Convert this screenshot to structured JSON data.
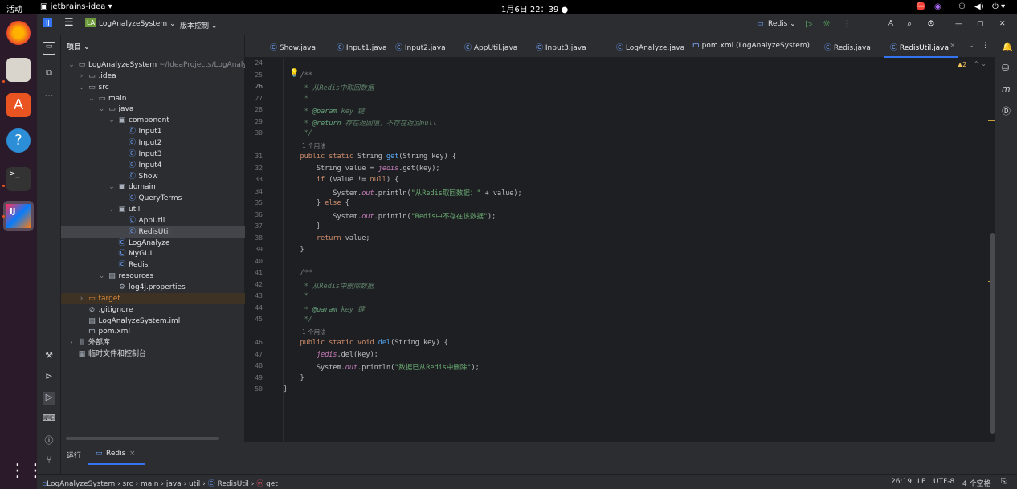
{
  "topbar": {
    "activities": "活动",
    "app_menu": "jetbrains-idea ▾",
    "clock": "1月6日 22：39 ●"
  },
  "header": {
    "project_badge": "LA",
    "project_name": "LogAnalyzeSystem ⌄",
    "vcs": "版本控制 ⌄",
    "run_config": "Redis ⌄"
  },
  "project_panel": {
    "title": "项目 ⌄",
    "tree": [
      {
        "label": "LogAnalyzeSystem",
        "extra": "~/IdeaProjects/LogAnalyzeSystem",
        "arrow": "⌄",
        "icon": "▭"
      },
      {
        "label": ".idea",
        "arrow": "›",
        "icon": "▭"
      },
      {
        "label": "src",
        "arrow": "⌄",
        "icon": "▭"
      },
      {
        "label": "main",
        "arrow": "⌄",
        "icon": "▭"
      },
      {
        "label": "java",
        "arrow": "⌄",
        "icon": "▭"
      },
      {
        "label": "component",
        "arrow": "⌄",
        "icon": "▣"
      },
      {
        "label": "Input1",
        "icon": "Ⓒ"
      },
      {
        "label": "Input2",
        "icon": "Ⓒ"
      },
      {
        "label": "Input3",
        "icon": "Ⓒ"
      },
      {
        "label": "Input4",
        "icon": "Ⓒ"
      },
      {
        "label": "Show",
        "icon": "Ⓒ"
      },
      {
        "label": "domain",
        "arrow": "⌄",
        "icon": "▣"
      },
      {
        "label": "QueryTerms",
        "icon": "Ⓒ"
      },
      {
        "label": "util",
        "arrow": "⌄",
        "icon": "▣"
      },
      {
        "label": "AppUtil",
        "icon": "Ⓒ"
      },
      {
        "label": "RedisUtil",
        "icon": "Ⓒ"
      },
      {
        "label": "LogAnalyze",
        "icon": "Ⓒ"
      },
      {
        "label": "MyGUI",
        "icon": "Ⓒ"
      },
      {
        "label": "Redis",
        "icon": "Ⓒ"
      },
      {
        "label": "resources",
        "arrow": "⌄",
        "icon": "▤"
      },
      {
        "label": "log4j.properties",
        "icon": "⚙"
      },
      {
        "label": "target",
        "arrow": "›",
        "icon": "▭"
      },
      {
        "label": ".gitignore",
        "icon": "⊘"
      },
      {
        "label": "LogAnalyzeSystem.iml",
        "icon": "▤"
      },
      {
        "label": "pom.xml",
        "icon": "m"
      },
      {
        "label": "外部库",
        "arrow": "›",
        "icon": "⫼"
      },
      {
        "label": "临时文件和控制台",
        "icon": "▦"
      }
    ]
  },
  "tabs": [
    "Show.java",
    "Input1.java",
    "Input2.java",
    "AppUtil.java",
    "Input3.java",
    "LogAnalyze.java",
    "pom.xml (LogAnalyzeSystem)",
    "Redis.java",
    "RedisUtil.java"
  ],
  "editor": {
    "warnings": "▲2",
    "usages_hint": "1 个用法"
  },
  "run_panel": {
    "title": "运行",
    "tab": "Redis"
  },
  "status": {
    "breadcrumbs": [
      "LogAnalyzeSystem",
      "src",
      "main",
      "java",
      "util",
      "RedisUtil",
      "get"
    ],
    "position": "26:19",
    "line_sep": "LF",
    "encoding": "UTF-8",
    "indent": "4 个空格"
  },
  "colors": {
    "accent": "#3574f0",
    "keyword": "#cf8e6d",
    "string": "#6aab73",
    "comment": "#7a7e85"
  }
}
